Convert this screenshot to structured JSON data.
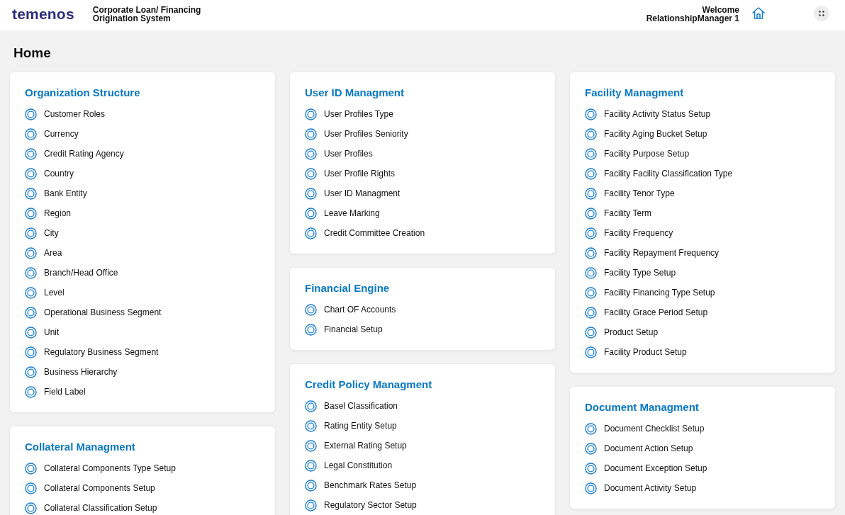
{
  "header": {
    "logo": "temenos",
    "app_title": "Corporate Loan/ Financing Origination System",
    "welcome": "Welcome",
    "user": "RelationshipManager 1"
  },
  "page_title": "Home",
  "columns": [
    {
      "cards": [
        {
          "title": "Organization Structure",
          "items": [
            "Customer Roles",
            "Currency",
            "Credit Rating Agency",
            "Country",
            "Bank Entity",
            "Region",
            "City",
            "Area",
            "Branch/Head Office",
            "Level",
            "Operational Business Segment",
            "Unit",
            "Regulatory Business Segment",
            "Business Hierarchy",
            "Field Label"
          ]
        },
        {
          "title": "Collateral Managment",
          "items": [
            "Collateral Components Type Setup",
            "Collateral Components Setup",
            "Collateral Classification Setup"
          ]
        }
      ]
    },
    {
      "cards": [
        {
          "title": "User ID Managment",
          "items": [
            "User Profiles Type",
            "User Profiles Seniority",
            "User Profiles",
            "User Profile Rights",
            "User ID Managment",
            "Leave Marking",
            "Credit Committee Creation"
          ]
        },
        {
          "title": "Financial Engine",
          "items": [
            "Chart OF Accounts",
            "Financial Setup"
          ]
        },
        {
          "title": "Credit Policy Managment",
          "items": [
            "Basel Classification",
            "Rating Entity Setup",
            "External Rating Setup",
            "Legal Constitution",
            "Benchmark Rates Setup",
            "Regulatory Sector Setup"
          ]
        }
      ]
    },
    {
      "cards": [
        {
          "title": "Facility Managment",
          "items": [
            "Facility Activity Status Setup",
            "Facility Aging Bucket Setup",
            "Facility Purpose Setup",
            "Facility Facility Classification Type",
            "Facility Tenor Type",
            "Facility Term",
            "Facility Frequency",
            "Facility Repayment Frequency",
            "Facility Type Setup",
            "Facility Financing Type Setup",
            "Facility Grace Period Setup",
            "Product Setup",
            "Facility Product Setup"
          ]
        },
        {
          "title": "Document Managment",
          "items": [
            "Document Checklist Setup",
            "Document Action Setup",
            "Document Exception Setup",
            "Document Activity Setup"
          ]
        }
      ]
    }
  ]
}
